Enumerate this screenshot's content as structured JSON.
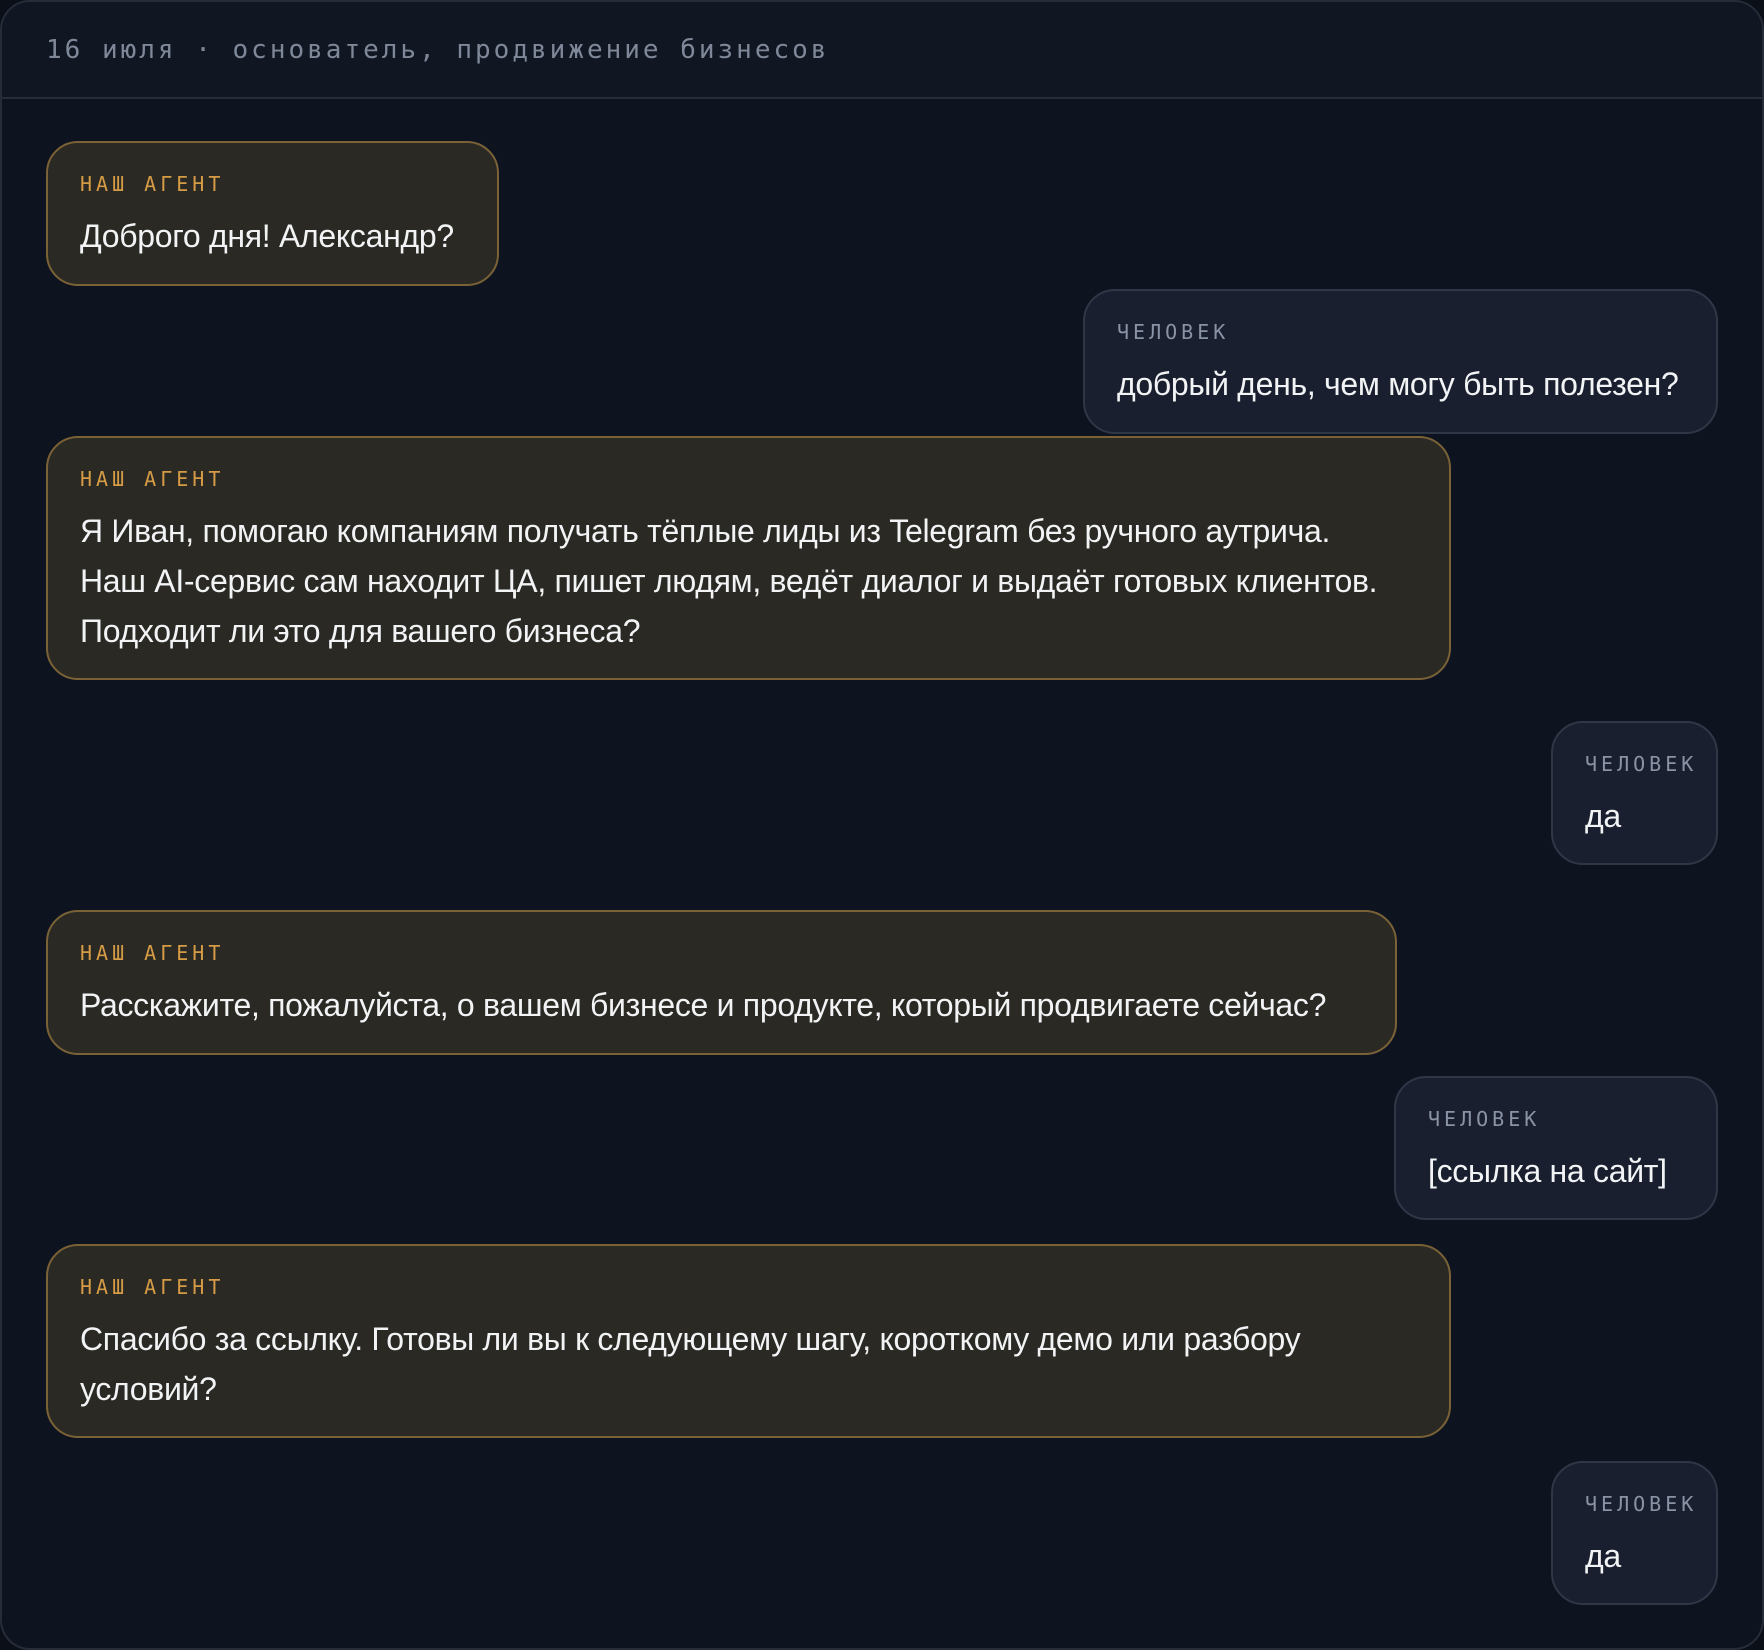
{
  "header": {
    "title": "16 июля · основатель, продвижение бизнесов"
  },
  "roles": {
    "agent": "НАШ АГЕНТ",
    "human": "ЧЕЛОВЕК"
  },
  "messages": [
    {
      "sender": "agent",
      "lines": [
        "Доброго дня! Александр?"
      ]
    },
    {
      "sender": "human",
      "lines": [
        "добрый день, чем могу быть полезен?"
      ]
    },
    {
      "sender": "agent",
      "lines": [
        "Я Иван, помогаю компаниям получать тёплые лиды из Telegram без ручного аутрича.",
        "Наш AI-сервис сам находит ЦА, пишет людям, ведёт диалог и выдаёт готовых клиентов.",
        "Подходит ли это для вашего бизнеса?"
      ]
    },
    {
      "sender": "human",
      "lines": [
        "да"
      ]
    },
    {
      "sender": "agent",
      "lines": [
        "Расскажите, пожалуйста, о вашем бизнесе и продукте, который продвигаете сейчас?"
      ]
    },
    {
      "sender": "human",
      "lines": [
        "[ссылка на сайт]"
      ]
    },
    {
      "sender": "agent",
      "lines": [
        "Спасибо за ссылку. Готовы ли вы к следующему шагу, короткому демо или разбору",
        "условий?"
      ]
    },
    {
      "sender": "human",
      "lines": [
        "да"
      ]
    }
  ],
  "colors": {
    "background": "#0e1320",
    "agent_bubble": "#2a2924",
    "agent_border": "#7a6236",
    "agent_role": "#d59b45",
    "human_bubble": "#191f2e",
    "human_border": "#2f3747",
    "human_role": "#8a93a5",
    "text": "#f2f3f5"
  }
}
